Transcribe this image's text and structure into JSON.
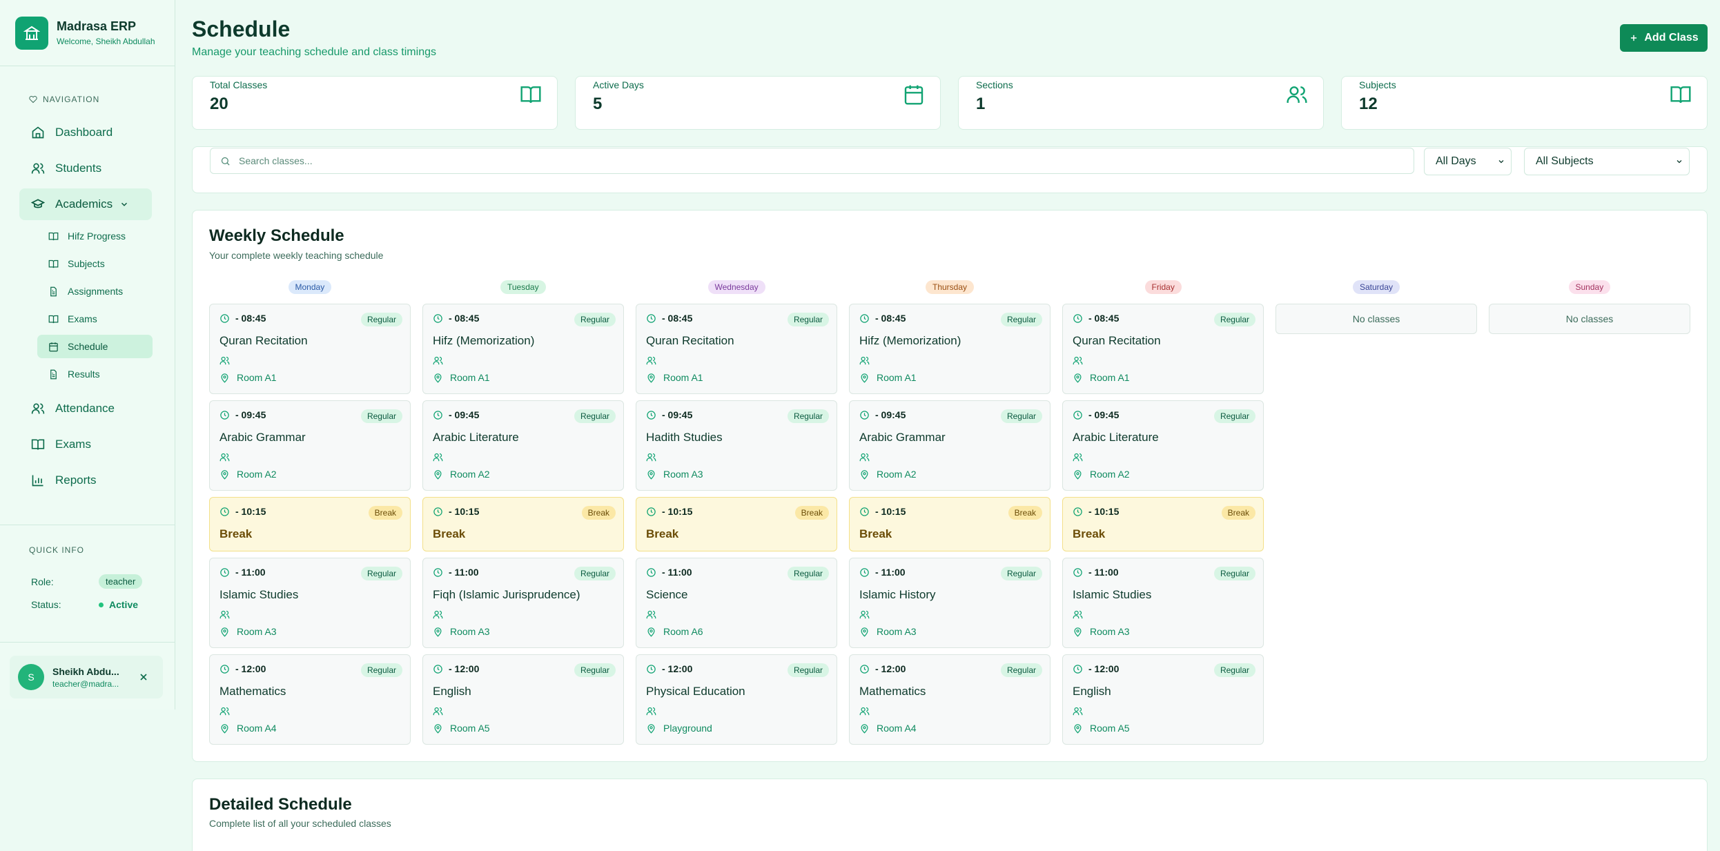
{
  "brand": {
    "title": "Madrasa ERP",
    "subtitle": "Welcome, Sheikh Abdullah"
  },
  "nav": {
    "heading": "NAVIGATION",
    "items": [
      "Dashboard",
      "Students",
      "Academics",
      "Attendance",
      "Exams",
      "Reports"
    ],
    "sub_items": [
      "Hifz Progress",
      "Subjects",
      "Assignments",
      "Exams",
      "Schedule",
      "Results"
    ]
  },
  "quick_info": {
    "heading": "QUICK INFO",
    "role_label": "Role:",
    "role": "teacher",
    "status_label": "Status:",
    "status": "Active"
  },
  "user": {
    "initial": "S",
    "name": "Sheikh Abdu...",
    "email": "teacher@madra..."
  },
  "header": {
    "title": "Schedule",
    "subtitle": "Manage your teaching schedule and class timings",
    "add_button": "Add Class"
  },
  "stats": [
    {
      "label": "Total Classes",
      "value": "20",
      "icon": "book-open-icon"
    },
    {
      "label": "Active Days",
      "value": "5",
      "icon": "calendar-icon"
    },
    {
      "label": "Sections",
      "value": "1",
      "icon": "users-icon"
    },
    {
      "label": "Subjects",
      "value": "12",
      "icon": "book-open-icon"
    }
  ],
  "filters": {
    "search_placeholder": "Search classes...",
    "day_select": "All Days",
    "subject_select": "All Subjects"
  },
  "weekly": {
    "title": "Weekly Schedule",
    "subtitle": "Your complete weekly teaching schedule",
    "no_classes": "No classes",
    "days": [
      {
        "name": "Monday",
        "bg": "#dbe9fb",
        "fg": "#2a5aa6",
        "classes": [
          {
            "time": "- 08:45",
            "type": "Regular",
            "subject": "Quran Recitation",
            "room": "Room A1"
          },
          {
            "time": "- 09:45",
            "type": "Regular",
            "subject": "Arabic Grammar",
            "room": "Room A2"
          },
          {
            "time": "- 10:15",
            "type": "Break",
            "subject": "Break",
            "room": ""
          },
          {
            "time": "- 11:00",
            "type": "Regular",
            "subject": "Islamic Studies",
            "room": "Room A3"
          },
          {
            "time": "- 12:00",
            "type": "Regular",
            "subject": "Mathematics",
            "room": "Room A4"
          }
        ]
      },
      {
        "name": "Tuesday",
        "bg": "#d7f5e3",
        "fg": "#1b7a4b",
        "classes": [
          {
            "time": "- 08:45",
            "type": "Regular",
            "subject": "Hifz (Memorization)",
            "room": "Room A1"
          },
          {
            "time": "- 09:45",
            "type": "Regular",
            "subject": "Arabic Literature",
            "room": "Room A2"
          },
          {
            "time": "- 10:15",
            "type": "Break",
            "subject": "Break",
            "room": ""
          },
          {
            "time": "- 11:00",
            "type": "Regular",
            "subject": "Fiqh (Islamic Jurisprudence)",
            "room": "Room A3"
          },
          {
            "time": "- 12:00",
            "type": "Regular",
            "subject": "English",
            "room": "Room A5"
          }
        ]
      },
      {
        "name": "Wednesday",
        "bg": "#efe0f8",
        "fg": "#7a3a9c",
        "classes": [
          {
            "time": "- 08:45",
            "type": "Regular",
            "subject": "Quran Recitation",
            "room": "Room A1"
          },
          {
            "time": "- 09:45",
            "type": "Regular",
            "subject": "Hadith Studies",
            "room": "Room A3"
          },
          {
            "time": "- 10:15",
            "type": "Break",
            "subject": "Break",
            "room": ""
          },
          {
            "time": "- 11:00",
            "type": "Regular",
            "subject": "Science",
            "room": "Room A6"
          },
          {
            "time": "- 12:00",
            "type": "Regular",
            "subject": "Physical Education",
            "room": "Playground"
          }
        ]
      },
      {
        "name": "Thursday",
        "bg": "#fde6cf",
        "fg": "#9a4f12",
        "classes": [
          {
            "time": "- 08:45",
            "type": "Regular",
            "subject": "Hifz (Memorization)",
            "room": "Room A1"
          },
          {
            "time": "- 09:45",
            "type": "Regular",
            "subject": "Arabic Grammar",
            "room": "Room A2"
          },
          {
            "time": "- 10:15",
            "type": "Break",
            "subject": "Break",
            "room": ""
          },
          {
            "time": "- 11:00",
            "type": "Regular",
            "subject": "Islamic History",
            "room": "Room A3"
          },
          {
            "time": "- 12:00",
            "type": "Regular",
            "subject": "Mathematics",
            "room": "Room A4"
          }
        ]
      },
      {
        "name": "Friday",
        "bg": "#fbdcdc",
        "fg": "#a83232",
        "classes": [
          {
            "time": "- 08:45",
            "type": "Regular",
            "subject": "Quran Recitation",
            "room": "Room A1"
          },
          {
            "time": "- 09:45",
            "type": "Regular",
            "subject": "Arabic Literature",
            "room": "Room A2"
          },
          {
            "time": "- 10:15",
            "type": "Break",
            "subject": "Break",
            "room": ""
          },
          {
            "time": "- 11:00",
            "type": "Regular",
            "subject": "Islamic Studies",
            "room": "Room A3"
          },
          {
            "time": "- 12:00",
            "type": "Regular",
            "subject": "English",
            "room": "Room A5"
          }
        ]
      },
      {
        "name": "Saturday",
        "bg": "#e0e3f8",
        "fg": "#3a4596",
        "classes": []
      },
      {
        "name": "Sunday",
        "bg": "#fbe0ec",
        "fg": "#a3325f",
        "classes": []
      }
    ]
  },
  "detailed": {
    "title": "Detailed Schedule",
    "subtitle": "Complete list of all your scheduled classes"
  }
}
